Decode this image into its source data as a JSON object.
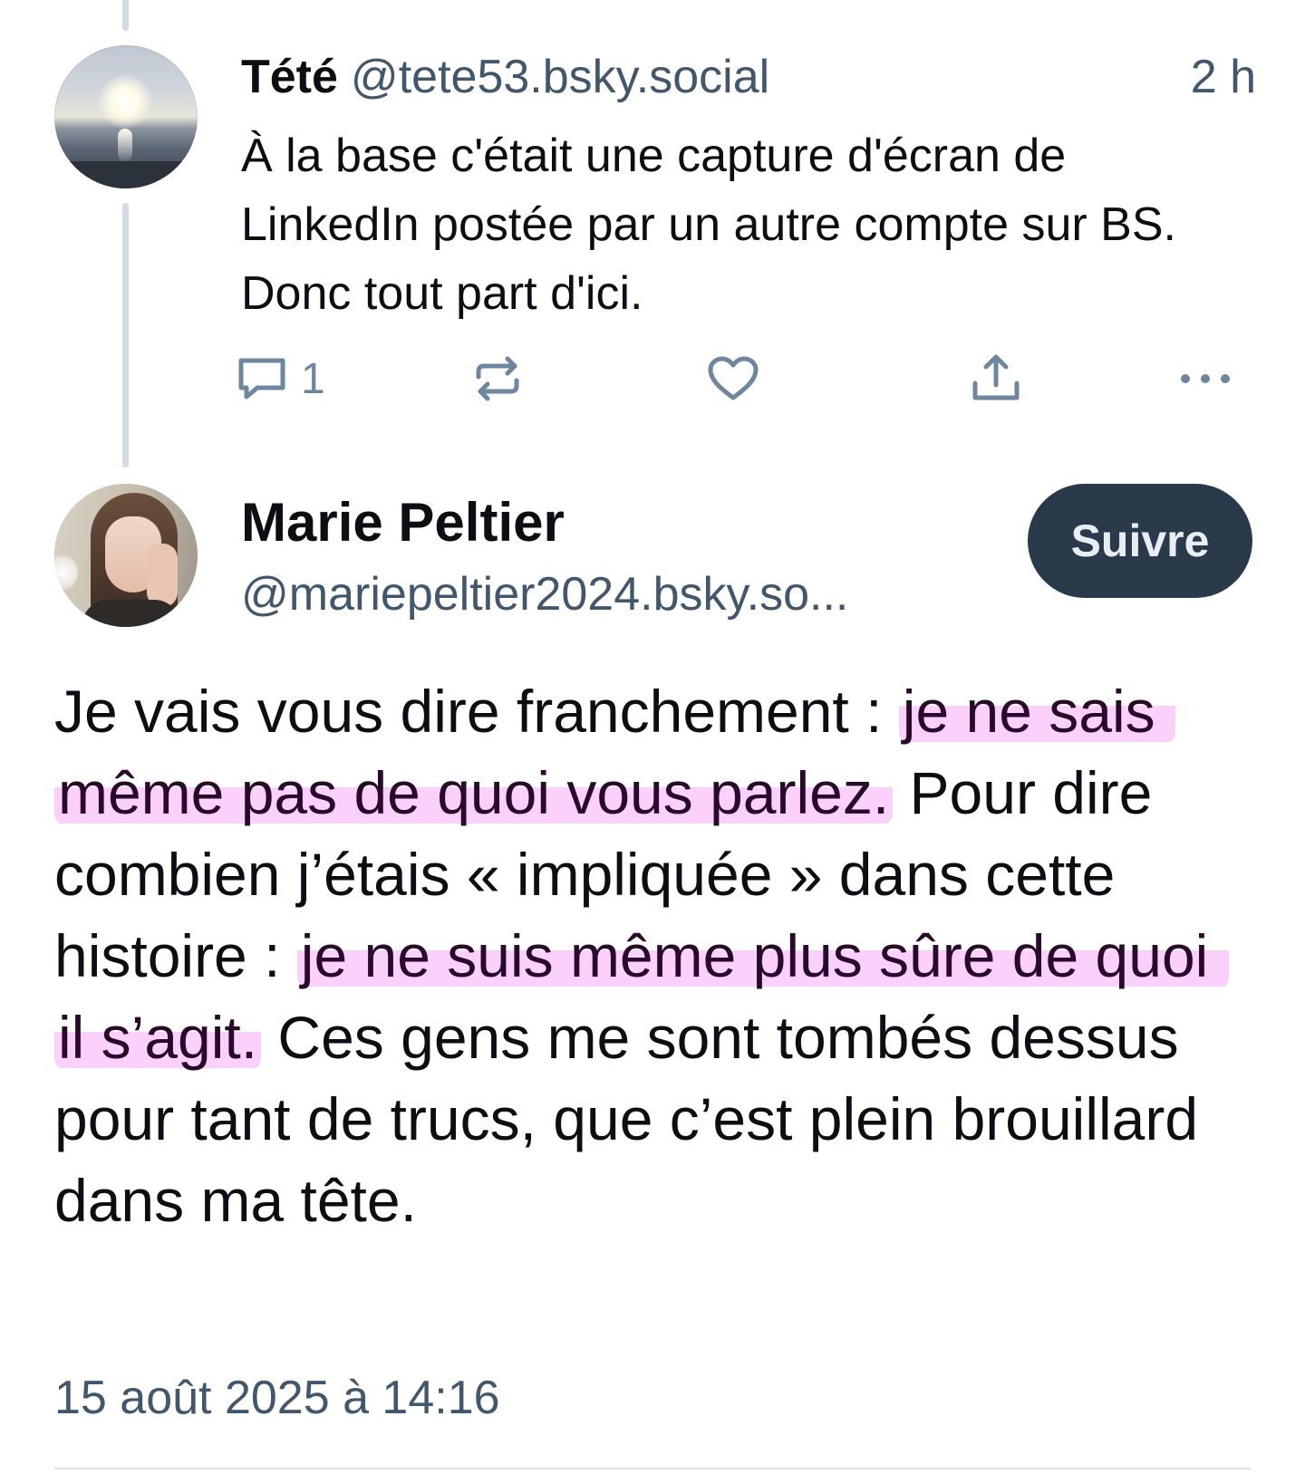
{
  "parent_post": {
    "display_name": "Tété",
    "handle": "@tete53.bsky.social",
    "time": "2 h",
    "text": "À la base c'était une capture d'écran de LinkedIn postée par un autre compte sur BS. Donc tout part d'ici.",
    "actions": {
      "reply_count": "1",
      "reply_icon": "speech-bubble-icon",
      "repost_icon": "repost-arrows-icon",
      "like_icon": "heart-icon",
      "share_icon": "share-upload-icon",
      "more_icon": "ellipsis-icon"
    }
  },
  "main_post": {
    "display_name": "Marie Peltier",
    "handle": "@mariepeltier2024.bsky.so...",
    "follow_label": "Suivre",
    "text_segments": [
      {
        "text": "Je vais vous dire franchement : ",
        "highlight": false
      },
      {
        "text": "je ne sais même pas de quoi vous parlez.",
        "highlight": true
      },
      {
        "text": " Pour dire combien j’étais « impliquée » dans cette histoire : ",
        "highlight": false
      },
      {
        "text": "je ne suis même plus sûre de quoi il s’agit.",
        "highlight": true
      },
      {
        "text": " Ces gens me sont tombés dessus pour tant de trucs, que c’est plein brouillard dans ma tête.",
        "highlight": false
      }
    ],
    "date": "15 août 2025 à 14:16"
  },
  "colors": {
    "text": "#0b0f14",
    "secondary_text": "#42576c",
    "icon": "#6f869f",
    "thread_line": "#d4dbe2",
    "follow_button_bg": "#2b3a4b",
    "highlight": "#f482f4"
  }
}
